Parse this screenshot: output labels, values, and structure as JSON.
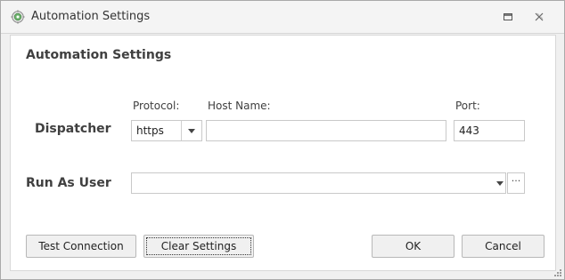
{
  "window": {
    "title": "Automation Settings"
  },
  "content": {
    "section_title": "Automation Settings",
    "dispatcher": {
      "label": "Dispatcher",
      "protocol_label": "Protocol:",
      "protocol_value": "https",
      "host_label": "Host Name:",
      "host_value": "",
      "port_label": "Port:",
      "port_value": "443"
    },
    "run_as": {
      "label": "Run As User",
      "value": "",
      "browse_label": "···"
    }
  },
  "buttons": {
    "test_connection": "Test Connection",
    "clear_settings": "Clear Settings",
    "ok": "OK",
    "cancel": "Cancel"
  },
  "icons": {
    "app": "gear-icon",
    "maximize": "maximize-icon",
    "close": "close-icon",
    "resize": "resize-grip-icon"
  }
}
